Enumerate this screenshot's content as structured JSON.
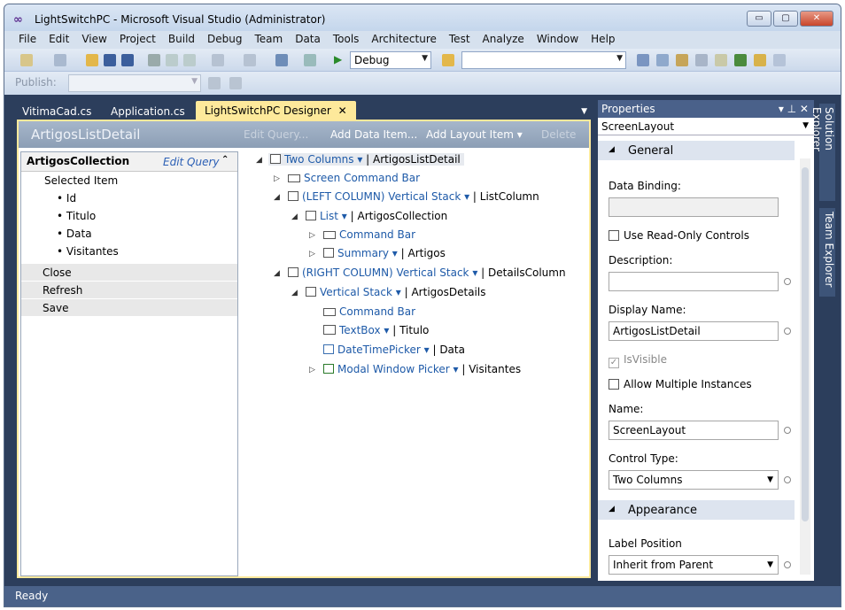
{
  "window": {
    "title": "LightSwitchPC - Microsoft Visual Studio (Administrator)",
    "minimize": "▭",
    "maximize": "▢",
    "close": "✕"
  },
  "menu": [
    "File",
    "Edit",
    "View",
    "Project",
    "Build",
    "Debug",
    "Team",
    "Data",
    "Tools",
    "Architecture",
    "Test",
    "Analyze",
    "Window",
    "Help"
  ],
  "toolbar": {
    "config": "Debug",
    "search": ""
  },
  "toolbar2": {
    "publish": "Publish:"
  },
  "tabs": [
    "VitimaCad.cs",
    "Application.cs",
    "LightSwitchPC Designer"
  ],
  "designer": {
    "title": "ArtigosListDetail",
    "edit_query": "Edit Query...",
    "add_data_item": "Add Data Item...",
    "add_layout_item": "Add Layout Item ▾",
    "delete": "Delete"
  },
  "left": {
    "collection": "ArtigosCollection",
    "edit_query": "Edit Query",
    "selected": "Selected Item",
    "fields": [
      "Id",
      "Titulo",
      "Data",
      "Visitantes"
    ],
    "commands": [
      "Close",
      "Refresh",
      "Save"
    ]
  },
  "tree": {
    "n0a": "Two Columns ▾",
    "n0b": "ArtigosListDetail",
    "n1": "Screen Command Bar",
    "n2a": "(LEFT COLUMN) Vertical Stack ▾",
    "n2b": "ListColumn",
    "n3a": "List ▾",
    "n3b": "ArtigosCollection",
    "n4": "Command Bar",
    "n5a": "Summary ▾",
    "n5b": "Artigos",
    "n6a": "(RIGHT COLUMN) Vertical Stack ▾",
    "n6b": "DetailsColumn",
    "n7a": "Vertical Stack ▾",
    "n7b": "ArtigosDetails",
    "n8": "Command Bar",
    "n9a": "TextBox ▾",
    "n9b": "Titulo",
    "n10a": "DateTimePicker ▾",
    "n10b": "Data",
    "n11a": "Modal Window Picker ▾",
    "n11b": "Visitantes"
  },
  "props": {
    "title": "Properties",
    "object": "ScreenLayout",
    "general": "General",
    "data_binding": "Data Binding:",
    "readonly": "Use Read-Only Controls",
    "description": "Description:",
    "display_name_label": "Display Name:",
    "display_name": "ArtigosListDetail",
    "isvisible": "IsVisible",
    "multi": "Allow Multiple Instances",
    "name_label": "Name:",
    "name": "ScreenLayout",
    "control_type_label": "Control Type:",
    "control_type": "Two Columns",
    "appearance": "Appearance",
    "label_position_label": "Label Position",
    "label_position": "Inherit from Parent"
  },
  "side_tabs": [
    "Solution Explorer",
    "Team Explorer"
  ],
  "status": "Ready"
}
